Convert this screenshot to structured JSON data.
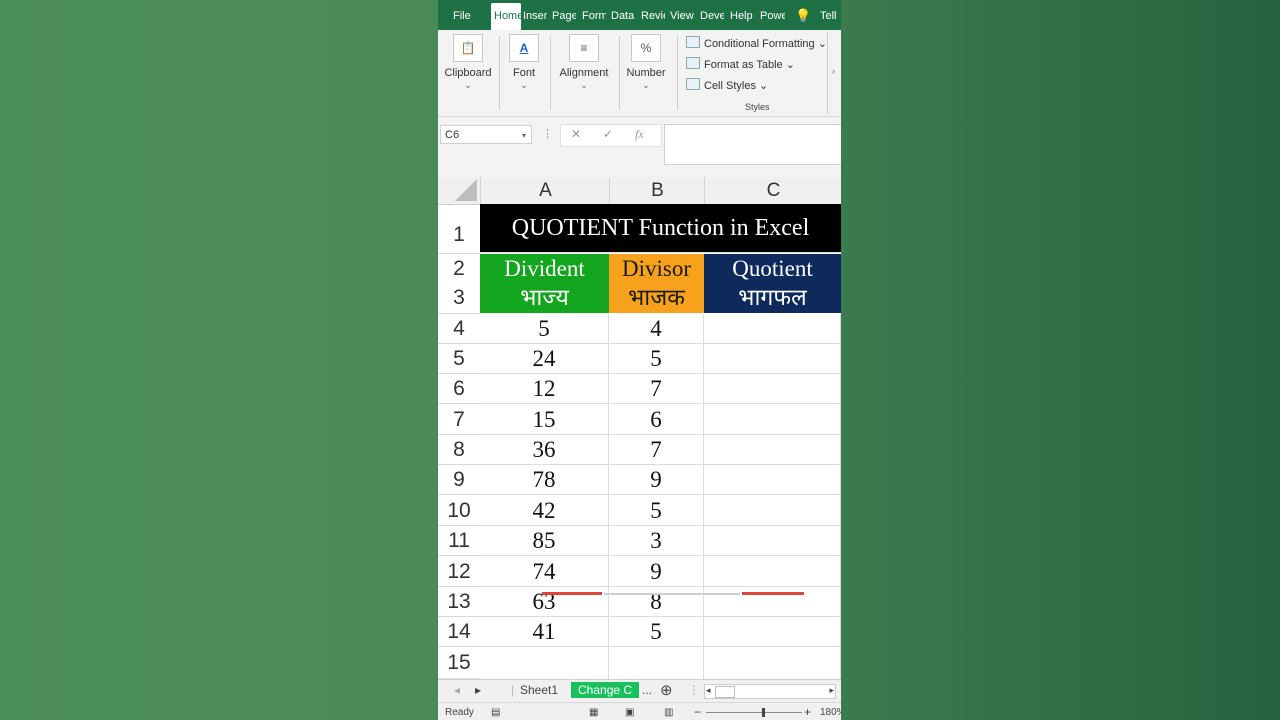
{
  "ribbon": {
    "tabs": [
      {
        "label": "File"
      },
      {
        "label": "Home"
      },
      {
        "label": "Insert"
      },
      {
        "label": "Page Layout"
      },
      {
        "label": "Formulas"
      },
      {
        "label": "Data"
      },
      {
        "label": "Review"
      },
      {
        "label": "View"
      },
      {
        "label": "Developer"
      },
      {
        "label": "Help"
      },
      {
        "label": "Power Pivot"
      },
      {
        "label": "Tell"
      }
    ],
    "groups": {
      "clipboard": "Clipboard",
      "font": "Font",
      "alignment": "Alignment",
      "number": "Number"
    },
    "styles": {
      "conditional": "Conditional Formatting",
      "format_table": "Format as Table",
      "cell_styles": "Cell Styles",
      "group_label": "Styles"
    }
  },
  "formula_bar": {
    "name_box": "C6",
    "cancel": "✕",
    "enter": "✓",
    "fx": "fx",
    "value": ""
  },
  "grid": {
    "columns": [
      "A",
      "B",
      "C"
    ],
    "rows": [
      "1",
      "2",
      "3",
      "4",
      "5",
      "6",
      "7",
      "8",
      "9",
      "10",
      "11",
      "12",
      "13",
      "14",
      "15"
    ],
    "title": "QUOTIENT Function in Excel",
    "headers": [
      {
        "line1": "Divident",
        "line2": "भाज्य"
      },
      {
        "line1": "Divisor",
        "line2": "भाजक"
      },
      {
        "line1": "Quotient",
        "line2": "भागफल"
      }
    ],
    "data": [
      {
        "a": "5",
        "b": "4",
        "c": ""
      },
      {
        "a": "24",
        "b": "5",
        "c": ""
      },
      {
        "a": "12",
        "b": "7",
        "c": ""
      },
      {
        "a": "15",
        "b": "6",
        "c": ""
      },
      {
        "a": "36",
        "b": "7",
        "c": ""
      },
      {
        "a": "78",
        "b": "9",
        "c": ""
      },
      {
        "a": "42",
        "b": "5",
        "c": ""
      },
      {
        "a": "85",
        "b": "3",
        "c": ""
      },
      {
        "a": "74",
        "b": "9",
        "c": ""
      },
      {
        "a": "63",
        "b": "8",
        "c": ""
      },
      {
        "a": "41",
        "b": "5",
        "c": ""
      }
    ]
  },
  "sheets": {
    "tab1": "Sheet1",
    "tab2": "Change C",
    "more": "...",
    "add": "⊕"
  },
  "status": {
    "ready": "Ready",
    "zoom": "180%"
  },
  "colors": {
    "excel_green": "#1e7145",
    "divident_bg": "#13a51d",
    "divisor_bg": "#f7a11c",
    "quotient_bg": "#0e2a5c",
    "title_bg": "#000000"
  }
}
